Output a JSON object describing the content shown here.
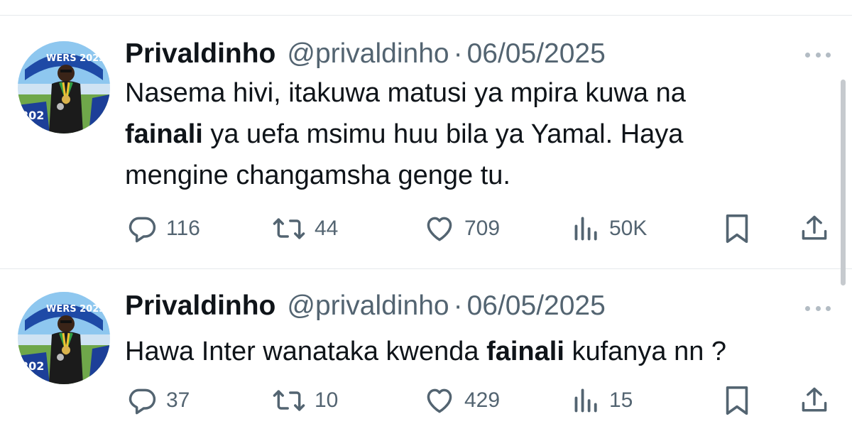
{
  "tweets": [
    {
      "name": "Privaldinho",
      "handle": "@privaldinho",
      "separator": "·",
      "date": "06/05/2025",
      "text": {
        "line1": "Nasema hivi, itakuwa matusi ya mpira kuwa na",
        "bold": "fainali",
        "after_bold": " ya uefa msimu huu bila ya Yamal. Haya",
        "line3": "mengine changamsha genge tu."
      },
      "stats": {
        "replies": "116",
        "reposts": "44",
        "likes": "709",
        "views": "50K"
      }
    },
    {
      "name": "Privaldinho",
      "handle": "@privaldinho",
      "separator": "·",
      "date": "06/05/2025",
      "text": {
        "before_bold": "Hawa Inter wanataka kwenda ",
        "bold": "fainali",
        "after_bold": " kufanya nn ?"
      },
      "stats": {
        "replies": "37",
        "reposts": "10",
        "likes": "429",
        "views": "15"
      }
    }
  ],
  "icons": {
    "reply": "speech-bubble",
    "repost": "repeat-arrows",
    "like": "heart",
    "views": "bar-chart",
    "bookmark": "bookmark",
    "share": "upload-arrow",
    "more": "three-dots"
  },
  "colors": {
    "text_primary": "#0f1419",
    "text_secondary": "#536471",
    "divider": "#e6e9ec",
    "more_dots": "#b3bcc4"
  }
}
